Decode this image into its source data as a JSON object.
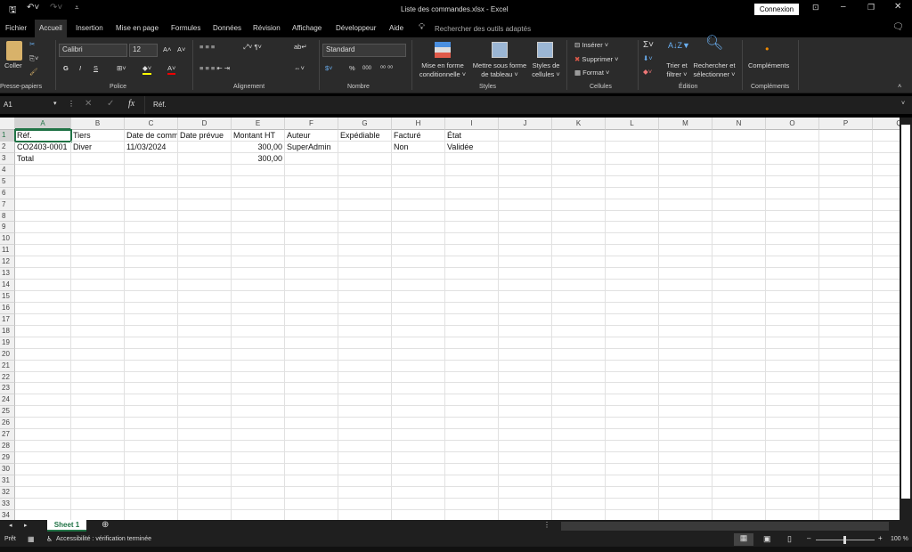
{
  "window": {
    "title": "Liste des commandes.xlsx  -  Excel",
    "signin": "Connexion"
  },
  "tabs": [
    "Fichier",
    "Accueil",
    "Insertion",
    "Mise en page",
    "Formules",
    "Données",
    "Révision",
    "Affichage",
    "Développeur",
    "Aide"
  ],
  "search_placeholder": "Rechercher des outils adaptés",
  "ribbon": {
    "paste": "Coller",
    "clipboard": "Presse-papiers",
    "font_name": "Calibri",
    "font_size": "12",
    "bold": "G",
    "italic": "I",
    "underline": "S",
    "font_group": "Police",
    "align_group": "Alignement",
    "number_format": "Standard",
    "percent": "%",
    "thousands": "000",
    "number_group": "Nombre",
    "cond_format": [
      "Mise en forme",
      "conditionnelle ˅"
    ],
    "as_table": [
      "Mettre sous forme",
      "de tableau ˅"
    ],
    "cell_styles": [
      "Styles de",
      "cellules ˅"
    ],
    "styles_group": "Styles",
    "insert": "Insérer",
    "delete": "Supprimer",
    "format": "Format",
    "cells_group": "Cellules",
    "sort": [
      "Trier et",
      "filtrer ˅"
    ],
    "find": [
      "Rechercher et",
      "sélectionner ˅"
    ],
    "edit_group": "Édition",
    "addins": "Compléments",
    "addins_group": "Compléments"
  },
  "formula_bar": {
    "name_box": "A1",
    "fx": "fx",
    "content": "Réf."
  },
  "columns": [
    "A",
    "B",
    "C",
    "D",
    "E",
    "F",
    "G",
    "H",
    "I",
    "J",
    "K",
    "L",
    "M",
    "N",
    "O",
    "P",
    "Q"
  ],
  "row_count": 34,
  "rows": [
    [
      "Réf.",
      "Tiers",
      "Date de commande",
      "Date prévue",
      "Montant HT",
      "Auteur",
      "Expédiable",
      "Facturé",
      "État"
    ],
    [
      "CO2403-0001",
      "Diver",
      "11/03/2024",
      "",
      "300,00",
      "SuperAdmin",
      "",
      "Non",
      "Validée"
    ],
    [
      "Total",
      "",
      "",
      "",
      "300,00",
      "",
      "",
      "",
      ""
    ]
  ],
  "sheet_tab": "Sheet 1",
  "status": {
    "ready": "Prêt",
    "accessibility": "Accessibilité : vérification terminée",
    "zoom": "100 %"
  }
}
